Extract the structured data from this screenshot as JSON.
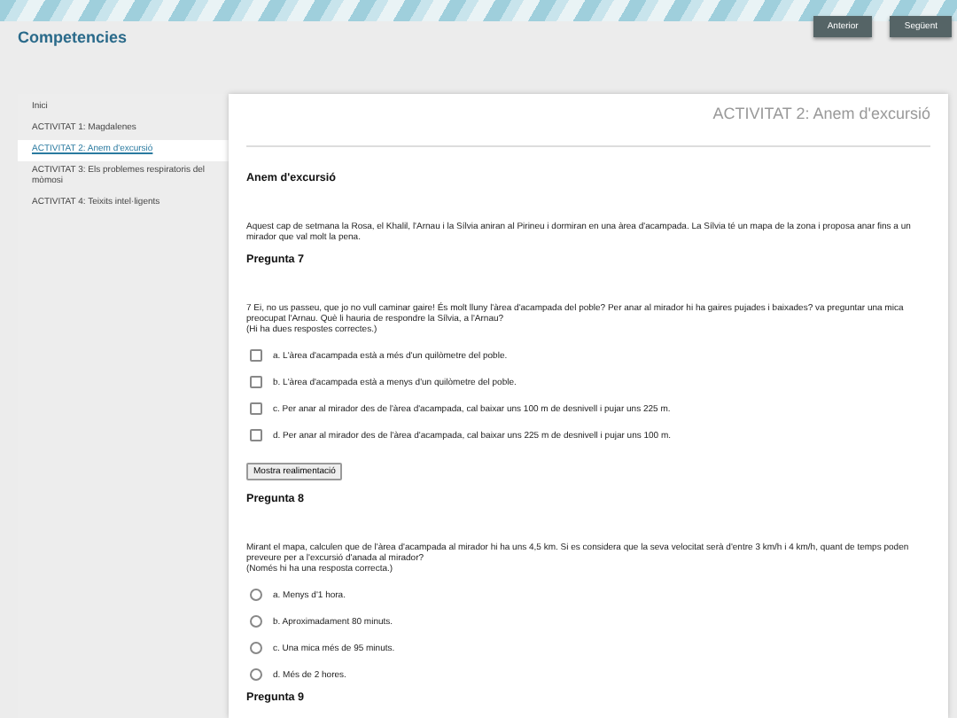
{
  "header": {
    "title": "Competencies",
    "buttons": [
      "Anterior",
      "Següent"
    ]
  },
  "sidebar": {
    "items": [
      {
        "label": "Inici",
        "selected": false
      },
      {
        "label": "ACTIVITAT 1: Magdalenes",
        "selected": false
      },
      {
        "label": "ACTIVITAT 2: Anem d'excursió",
        "selected": true
      },
      {
        "label": "ACTIVITAT 3: Els problemes respiratoris del mòmosi",
        "selected": false
      },
      {
        "label": "ACTIVITAT 4: Teixits intel·ligents",
        "selected": false
      }
    ]
  },
  "content": {
    "title": "ACTIVITAT 2: Anem d'excursió",
    "subtitle": "Anem d'excursió",
    "intro": "Aquest cap de setmana la Rosa, el Khalil, l'Arnau i la Sílvia aniran al Pirineu i dormiran en una àrea d'acampada. La Sílvia té un mapa de la zona i proposa anar fins a un mirador que val molt la pena.",
    "questions": [
      {
        "heading": "Pregunta 7",
        "text": [
          "7 Ei, no us passeu, que jo no vull caminar gaire! És molt lluny l'àrea d'acampada del poble? Per anar al mirador hi ha gaires pujades i baixades? va preguntar una mica preocupat l'Arnau. Què li hauria de respondre la Sílvia, a l'Arnau?",
          "(Hi ha dues respostes correctes.)"
        ],
        "kind": "checkbox",
        "options": [
          {
            "label": "a. L'àrea d'acampada està a més d'un quilòmetre del poble.",
            "checked": false
          },
          {
            "label": "b. L'àrea d'acampada està a menys d'un quilòmetre del poble.",
            "checked": false
          },
          {
            "label": "c. Per anar al mirador des de l'àrea d'acampada, cal baixar uns 100 m de desnivell i pujar uns 225 m.",
            "checked": false
          },
          {
            "label": "d. Per anar al mirador des de l'àrea d'acampada, cal baixar uns 225 m de desnivell i pujar uns 100 m.",
            "checked": false
          }
        ],
        "feedback_button": "Mostra realimentació"
      },
      {
        "heading": "Pregunta 8",
        "text": [
          "Mirant el mapa, calculen que de l'àrea d'acampada al mirador hi ha uns 4,5 km. Si es considera que la seva velocitat serà d'entre 3 km/h i 4 km/h, quant de temps poden preveure per a l'excursió d'anada al mirador?",
          "(Només hi ha una resposta correcta.)"
        ],
        "kind": "radio",
        "options": [
          {
            "label": "a. Menys d'1 hora.",
            "checked": false
          },
          {
            "label": "b. Aproximadament 80 minuts.",
            "checked": false
          },
          {
            "label": "c. Una mica més de 95 minuts.",
            "checked": false
          },
          {
            "label": "d. Més de 2 hores.",
            "checked": false
          }
        ]
      },
      {
        "heading": "Pregunta 9"
      }
    ]
  }
}
